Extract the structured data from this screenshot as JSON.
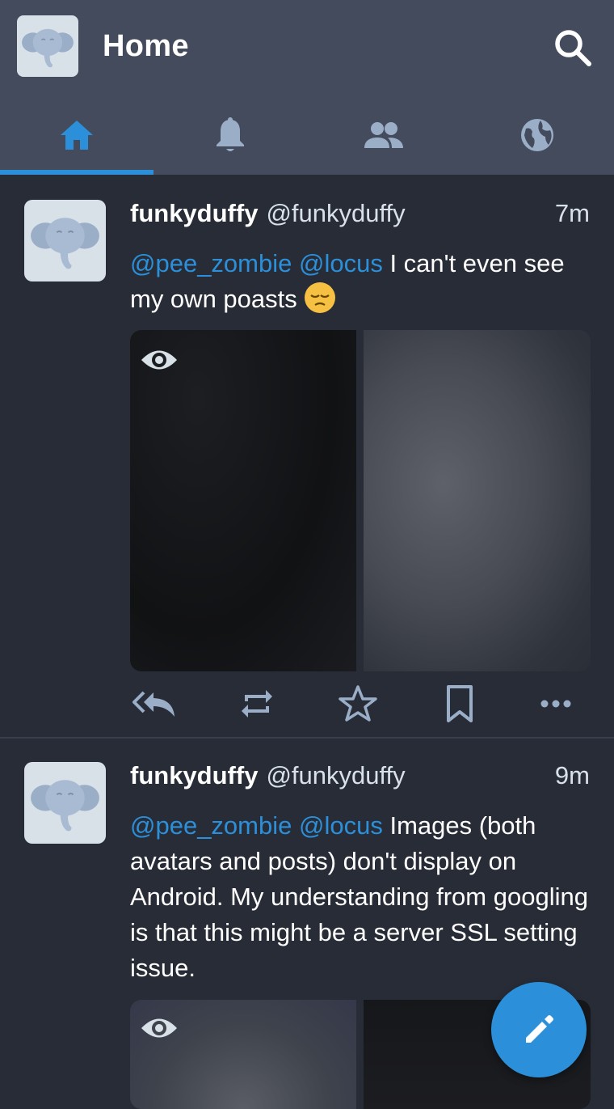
{
  "header": {
    "title": "Home",
    "search_icon": "search-icon",
    "avatar_icon": "mastodon-elephant-icon"
  },
  "tabs": [
    {
      "name": "home",
      "icon": "home-icon",
      "active": true
    },
    {
      "name": "notifications",
      "icon": "bell-icon",
      "active": false
    },
    {
      "name": "local",
      "icon": "people-icon",
      "active": false
    },
    {
      "name": "federated",
      "icon": "globe-icon",
      "active": false
    }
  ],
  "posts": [
    {
      "display_name": "funkyduffy",
      "acct": "@funkyduffy",
      "time": "7m",
      "mention1": "@pee_zombie",
      "mention2": "@locus",
      "text": " I can't even see my own poasts ",
      "emoji": "pensive-face-emoji"
    },
    {
      "display_name": "funkyduffy",
      "acct": "@funkyduffy",
      "time": "9m",
      "mention1": "@pee_zombie",
      "mention2": "@locus",
      "text": " Images (both avatars and posts) don't display on Android. My understanding from googling is that this might be a server SSL setting issue."
    }
  ],
  "colors": {
    "accent": "#2b90d9",
    "background": "#282c37",
    "header": "#444b5d",
    "icon": "#9baec8"
  },
  "fab": {
    "icon": "pencil-icon"
  }
}
